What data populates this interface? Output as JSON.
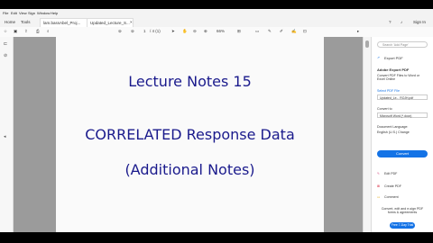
{
  "menu": [
    "File",
    "Edit",
    "View",
    "Sign",
    "Window",
    "Help"
  ],
  "tabs": {
    "home": "Home",
    "tools": "Tools",
    "doc1": "lam.bassAbel_Proj...",
    "doc2": "Updated_Lecture_S..."
  },
  "header": {
    "signin": "Sign In"
  },
  "toolbar": {
    "page": "1",
    "page_total": "/ 4 (1)",
    "zoom": "66%"
  },
  "page": {
    "line1": "Lecture Notes 15",
    "line2": "CORRELATED Response Data",
    "line3": "(Additional Notes)"
  },
  "panel": {
    "search_placeholder": "Search 'Add Page'",
    "export_title": "Export PDF",
    "adobe_export": "Adobe Export PDF",
    "description": "Convert PDF Files to Word or Excel Online",
    "select_label": "Select PDF File",
    "file_name": "Updated_Le... ROJH.pdf",
    "convert_to_label": "Convert to",
    "convert_to_value": "Microsoft Word (*.docx)",
    "doc_lang_label": "Document Language:",
    "doc_lang_value": "English (U.S.) Change",
    "convert_button": "Convert",
    "edit_pdf": "Edit PDF",
    "create_pdf": "Create PDF",
    "comment": "Comment",
    "promo": "Convert, edit and e-sign PDF forms & agreements",
    "try_button": "Free 7-Day Trial"
  },
  "colors": {
    "accent": "#1473e6",
    "title_text": "#1a1a8c"
  }
}
